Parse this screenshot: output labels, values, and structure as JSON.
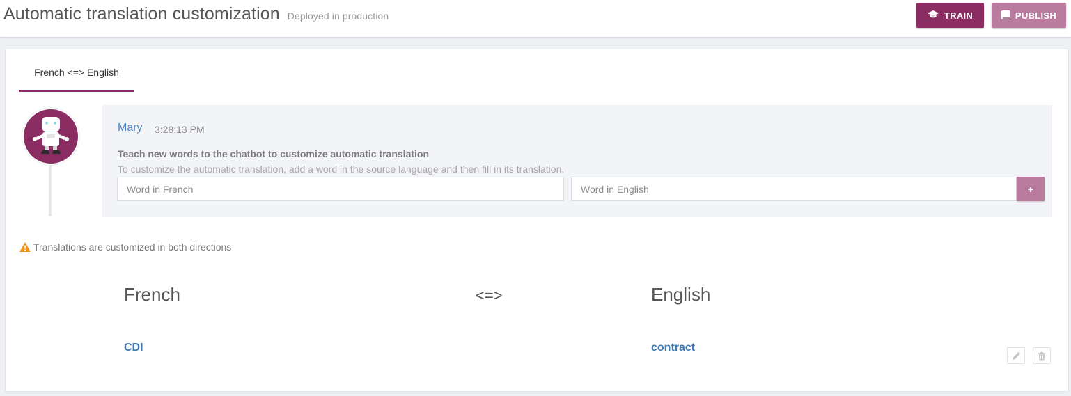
{
  "header": {
    "title": "Automatic translation customization",
    "subtitle": "Deployed in production",
    "train_label": "TRAIN",
    "publish_label": "PUBLISH",
    "train_icon": "graduation-cap-icon",
    "publish_icon": "book-icon"
  },
  "tabs": [
    {
      "label": "French <=> English",
      "active": true
    }
  ],
  "message": {
    "author": "Mary",
    "time": "3:28:13 PM",
    "title": "Teach new words to the chatbot to customize automatic translation",
    "description": "To customize the automatic translation, add a word in the source language and then fill in its translation.",
    "source_placeholder": "Word in French",
    "target_placeholder": "Word in English",
    "add_label": "+"
  },
  "warning": {
    "text": "Translations are customized in both directions",
    "icon": "warning-icon"
  },
  "table": {
    "source_header": "French",
    "arrow": "<=>",
    "target_header": "English",
    "rows": [
      {
        "source": "CDI",
        "target": "contract"
      }
    ]
  },
  "colors": {
    "brand": "#8b2d63",
    "brand_light": "#b97c9e",
    "link": "#3f78b4",
    "warning": "#f0921e"
  }
}
